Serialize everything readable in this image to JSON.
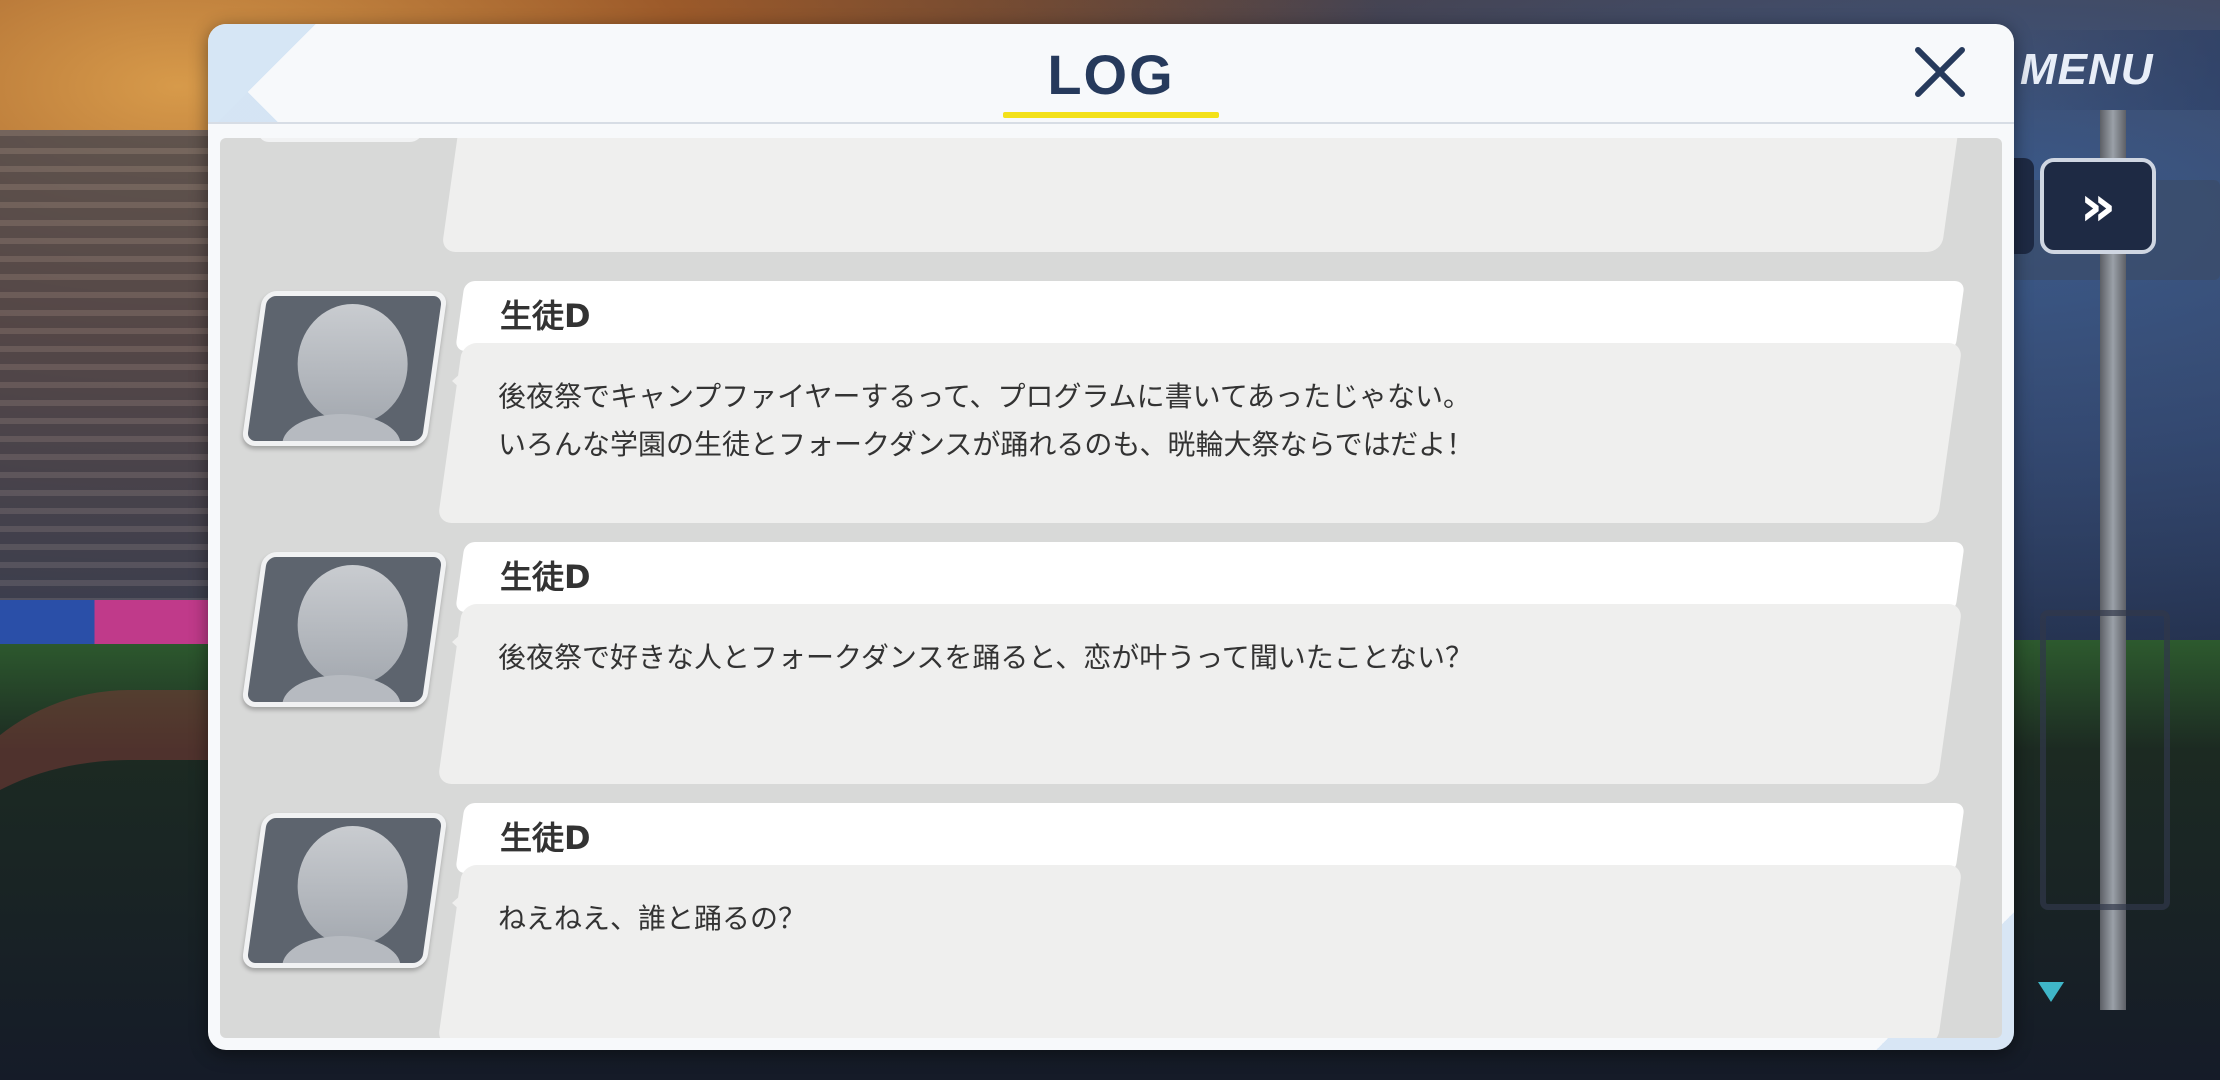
{
  "hud": {
    "menu_label": "MENU",
    "skip_icon": "fast-forward-icon",
    "scroll_down_icon": "triangle-down-icon"
  },
  "dialog": {
    "title": "LOG",
    "close_icon": "close-icon",
    "accent_color": "#f3e11a",
    "title_color": "#263a5c"
  },
  "log": {
    "entries": [
      {
        "name": "生徒D",
        "avatar_icon": "placeholder-avatar-icon",
        "text": "後夜祭でキャンプファイヤーするって、プログラムに書いてあったじゃない。\nいろんな学園の生徒とフォークダンスが踊れるのも、晄輪大祭ならではだよ！"
      },
      {
        "name": "生徒D",
        "avatar_icon": "placeholder-avatar-icon",
        "text": "後夜祭で好きな人とフォークダンスを踊ると、恋が叶うって聞いたことない？"
      },
      {
        "name": "生徒D",
        "avatar_icon": "placeholder-avatar-icon",
        "text": "ねえねえ、誰と踊るの？"
      }
    ]
  }
}
